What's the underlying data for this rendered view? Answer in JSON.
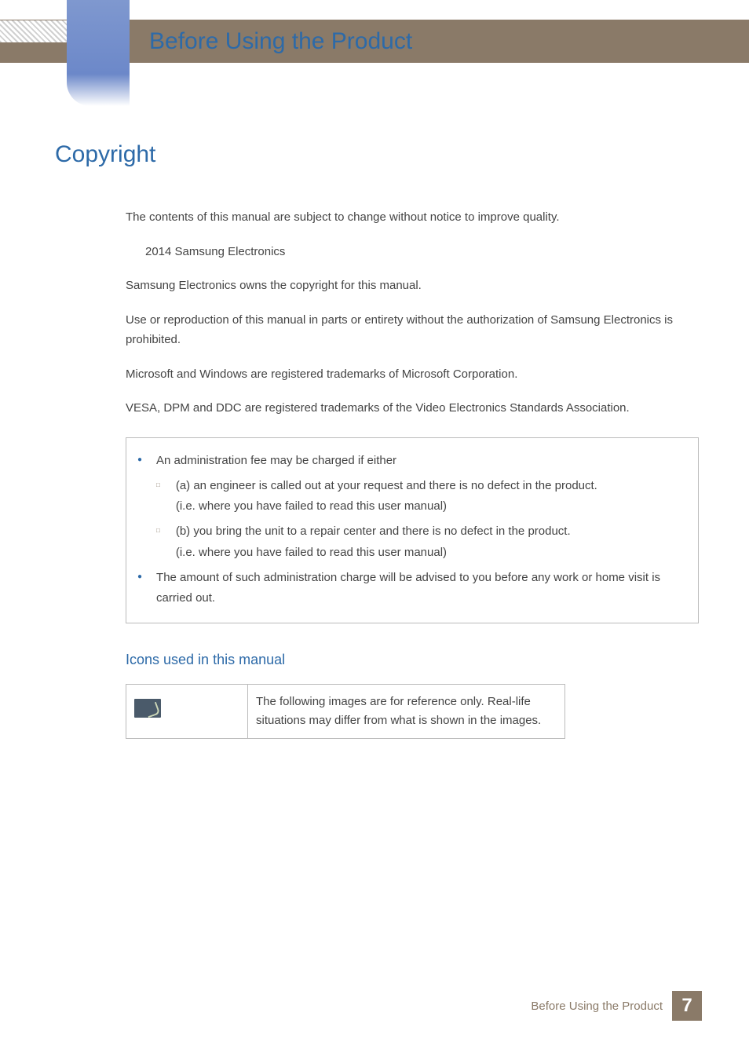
{
  "header": {
    "chapter_title": "Before Using the Product"
  },
  "section": {
    "heading": "Copyright",
    "para1": "The contents of this manual are subject to change without notice to improve quality.",
    "copyright_line": "2014 Samsung Electronics",
    "para2": "Samsung Electronics owns the copyright for this manual.",
    "para3": "Use or reproduction of this manual in parts or entirety without the authorization of Samsung Electronics is prohibited.",
    "para4": "Microsoft and Windows are registered trademarks of Microsoft Corporation.",
    "para5": "VESA, DPM and DDC are registered trademarks of the Video Electronics Standards Association."
  },
  "notice": {
    "line1": "An administration fee may be charged if either",
    "sub_a": "(a) an engineer is called out at your request and there is no defect in the product.",
    "sub_a2": "(i.e. where you have failed to read this user manual)",
    "sub_b": "(b) you bring the unit to a repair center and there is no defect in the product.",
    "sub_b2": "(i.e. where you have failed to read this user manual)",
    "line2": "The amount of such administration charge will be advised to you before any work or home visit is carried out."
  },
  "icons_section": {
    "heading": "Icons used in this manual",
    "description": "The following images are for reference only. Real-life situations may differ from what is shown in the images."
  },
  "footer": {
    "label": "Before Using the Product",
    "page_number": "7"
  }
}
